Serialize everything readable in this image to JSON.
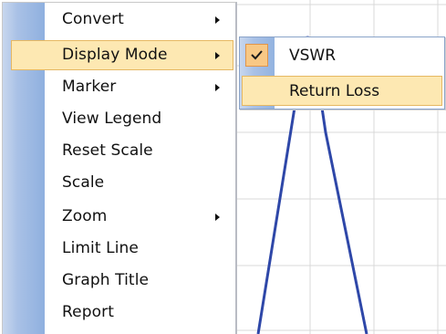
{
  "main_menu": {
    "items": [
      {
        "label": "Convert",
        "has_submenu": true
      },
      {
        "label": "Display Mode",
        "has_submenu": true,
        "highlighted": true
      },
      {
        "label": "Marker",
        "has_submenu": true
      },
      {
        "label": "View Legend",
        "has_submenu": false
      },
      {
        "label": "Reset Scale",
        "has_submenu": false
      },
      {
        "label": "Scale",
        "has_submenu": false
      },
      {
        "label": "Zoom",
        "has_submenu": true
      },
      {
        "label": "Limit Line",
        "has_submenu": false
      },
      {
        "label": "Graph Title",
        "has_submenu": false
      },
      {
        "label": "Report",
        "has_submenu": false
      }
    ]
  },
  "display_mode_submenu": {
    "items": [
      {
        "label": "VSWR",
        "checked": true
      },
      {
        "label": "Return Loss",
        "checked": false,
        "highlighted": true
      }
    ]
  },
  "icons": {
    "submenu_arrow": "chevron-right-icon",
    "check": "checkmark-icon"
  },
  "colors": {
    "highlight_fill": "#fde8b2",
    "highlight_border": "#e6b862",
    "trace": "#2e47a8",
    "grid": "#d9d9d9"
  }
}
